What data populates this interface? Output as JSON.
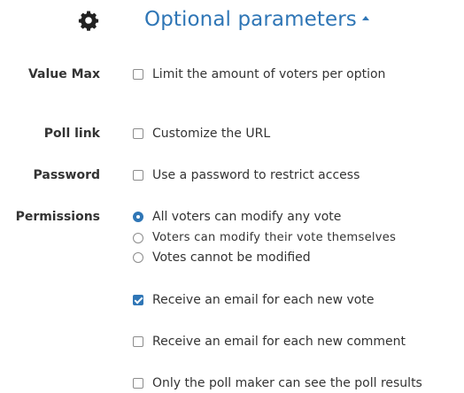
{
  "header": {
    "title": "Optional parameters",
    "icon": "gear-icon",
    "accent_color": "#2f76b6"
  },
  "rows": {
    "value_max": {
      "label": "Value Max",
      "option": "Limit the amount of voters per option",
      "checked": false
    },
    "poll_link": {
      "label": "Poll link",
      "option": "Customize the URL",
      "checked": false
    },
    "password": {
      "label": "Password",
      "option": "Use a password to restrict access",
      "checked": false
    },
    "permissions": {
      "label": "Permissions",
      "options": [
        {
          "label": "All voters can modify any vote",
          "selected": true
        },
        {
          "label": "Voters can modify their vote themselves",
          "selected": false
        },
        {
          "label": "Votes cannot be modified",
          "selected": false
        }
      ]
    },
    "notifications": {
      "email_vote": {
        "label": "Receive an email for each new vote",
        "checked": true
      },
      "email_comment": {
        "label": "Receive an email for each new comment",
        "checked": false
      },
      "results_hidden": {
        "label": "Only the poll maker can see the poll results",
        "checked": false
      }
    }
  }
}
